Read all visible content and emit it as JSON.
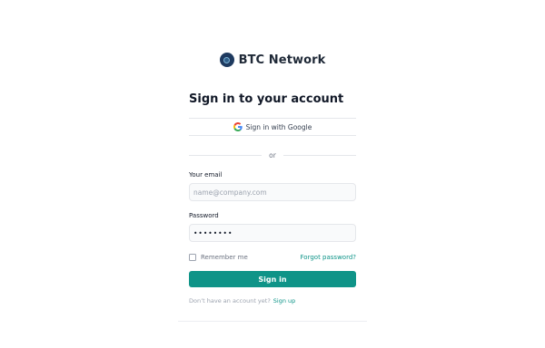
{
  "brand": {
    "name": "BTC Network",
    "logo_icon": "btc-network-logo"
  },
  "form": {
    "title": "Sign in to your account",
    "google_button_label": "Sign in with Google",
    "divider_text": "or",
    "email_label": "Your email",
    "email_placeholder": "name@company.com",
    "email_value": "",
    "password_label": "Password",
    "password_value": "••••••••",
    "remember_label": "Remember me",
    "remember_checked": false,
    "forgot_label": "Forgot password?",
    "submit_label": "Sign in",
    "signup_prompt": "Don’t have an account yet?",
    "signup_link": "Sign up"
  },
  "colors": {
    "accent": "#0f9488",
    "link": "#0d9488",
    "logo": "#1e3a5f"
  }
}
